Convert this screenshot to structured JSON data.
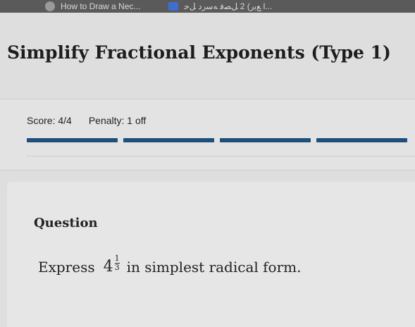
{
  "browser": {
    "tab1_title": "How to Draw a Nec...",
    "tab2_title": "...l ﻊﺑﺭ) 2 ﻞﺼﻓ ﻪﺳﺭﺩ ﻞﺣ"
  },
  "page": {
    "title": "Simplify Fractional Exponents (Type 1)"
  },
  "score": {
    "score_text": "Score: 4/4",
    "penalty_text": "Penalty: 1 off",
    "progress_segments": 4,
    "progress_completed": 4,
    "bar_color": "#1f4f7a"
  },
  "question": {
    "label": "Question",
    "prefix": "Express",
    "base": "4",
    "exp_numerator": "1",
    "exp_denominator": "3",
    "suffix": "in simplest radical form."
  }
}
